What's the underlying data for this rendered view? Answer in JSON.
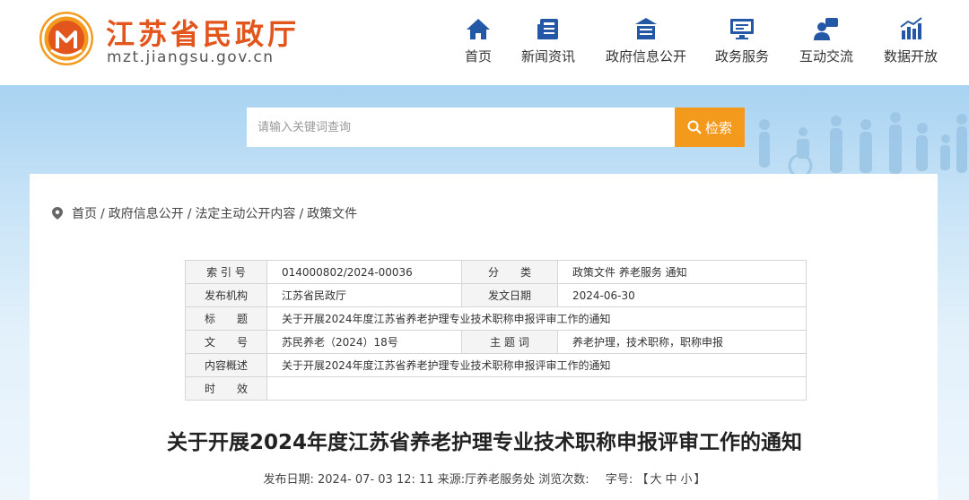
{
  "header": {
    "site_title": "江苏省民政厅",
    "site_domain": "mzt.jiangsu.gov.cn",
    "logo_icon": "civil-affairs-logo",
    "brand_color": "#e2551c"
  },
  "nav": [
    {
      "label": "首页",
      "icon": "home-icon"
    },
    {
      "label": "新闻资讯",
      "icon": "news-icon"
    },
    {
      "label": "政府信息公开",
      "icon": "building-icon"
    },
    {
      "label": "政务服务",
      "icon": "monitor-icon"
    },
    {
      "label": "互动交流",
      "icon": "chat-user-icon"
    },
    {
      "label": "数据开放",
      "icon": "bar-chart-icon"
    }
  ],
  "search": {
    "placeholder": "请输入关键词查询",
    "button_label": "检索",
    "button_color": "#f39a1d"
  },
  "breadcrumb": [
    "首页",
    "政府信息公开",
    "法定主动公开内容",
    "政策文件"
  ],
  "meta": {
    "index_label": "索 引 号",
    "index_value": "014000802/2024-00036",
    "category_label": "分　　类",
    "category_value": "政策文件 养老服务 通知",
    "publisher_label": "发布机构",
    "publisher_value": "江苏省民政厅",
    "date_label": "发文日期",
    "date_value": "2024-06-30",
    "title_label": "标　　题",
    "title_value": "关于开展2024年度江苏省养老护理专业技术职称申报评审工作的通知",
    "docno_label": "文　　号",
    "docno_value": "苏民养老（2024）18号",
    "keywords_label": "主 题 词",
    "keywords_value": "养老护理，技术职称，职称申报",
    "summary_label": "内容概述",
    "summary_value": "关于开展2024年度江苏省养老护理专业技术职称申报评审工作的通知",
    "validity_label": "时　　效",
    "validity_value": ""
  },
  "doc": {
    "title": "关于开展2024年度江苏省养老护理专业技术职称申报评审工作的通知",
    "pub_date_label": "发布日期:",
    "pub_date_value": "2024- 07- 03 12: 11",
    "source_label": "来源:",
    "source_value": "厅养老服务处",
    "views_label": "浏览次数:",
    "fontsize_label": "字号:",
    "fontsize_open": "【",
    "fontsize_large": "大",
    "fontsize_medium": "中",
    "fontsize_small": "小",
    "fontsize_close": "】"
  }
}
